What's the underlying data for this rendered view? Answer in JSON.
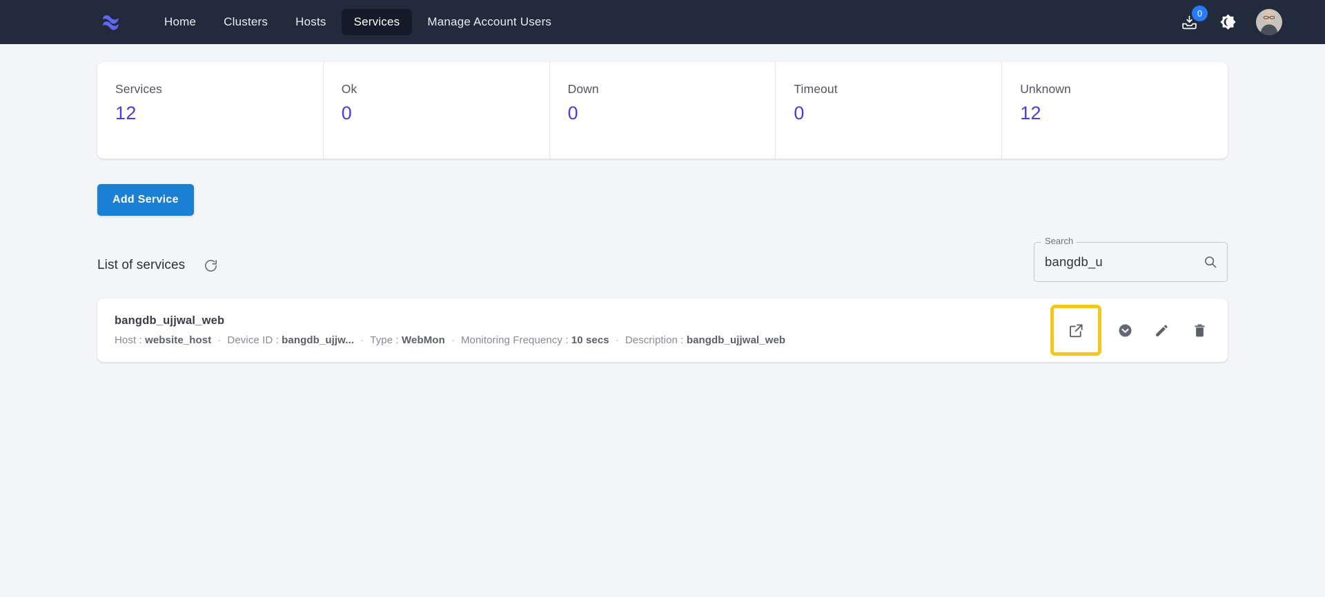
{
  "navbar": {
    "logo_icon": "wave-logo-icon",
    "links": [
      {
        "label": "Home",
        "active": false
      },
      {
        "label": "Clusters",
        "active": false
      },
      {
        "label": "Hosts",
        "active": false
      },
      {
        "label": "Services",
        "active": true
      },
      {
        "label": "Manage Account Users",
        "active": false
      }
    ],
    "inbox_icon": "inbox-download-icon",
    "inbox_badge": "0",
    "theme_toggle_icon": "brightness-dark-mode-icon",
    "avatar_icon": "user-avatar",
    "bg_color": "#222b3c",
    "active_tab_color": "#141a28",
    "badge_color": "#2979ff"
  },
  "stats": [
    {
      "label": "Services",
      "value": "12"
    },
    {
      "label": "Ok",
      "value": "0"
    },
    {
      "label": "Down",
      "value": "0"
    },
    {
      "label": "Timeout",
      "value": "0"
    },
    {
      "label": "Unknown",
      "value": "12"
    }
  ],
  "stat_value_color": "#4b3ddb",
  "toolbar": {
    "add_service_label": "Add Service",
    "add_service_color": "#1b7fd4",
    "list_title": "List of services",
    "refresh_icon": "refresh-icon"
  },
  "search": {
    "legend": "Search",
    "value": "bangdb_u",
    "placeholder": "",
    "icon": "search-icon"
  },
  "services": [
    {
      "name": "bangdb_ujjwal_web",
      "meta": [
        {
          "label": "Host :",
          "value": "website_host"
        },
        {
          "label": "Device ID :",
          "value": "bangdb_ujjw..."
        },
        {
          "label": "Type :",
          "value": "WebMon"
        },
        {
          "label": "Monitoring Frequency :",
          "value": "10 secs"
        },
        {
          "label": "Description :",
          "value": "bangdb_ujjwal_web"
        }
      ],
      "actions": [
        {
          "icon": "open-external-link-icon",
          "highlighted": true
        },
        {
          "icon": "chevron-down-circle-icon",
          "highlighted": false
        },
        {
          "icon": "edit-pencil-icon",
          "highlighted": false
        },
        {
          "icon": "delete-trash-icon",
          "highlighted": false
        }
      ]
    }
  ],
  "highlight_color": "#f6c619"
}
